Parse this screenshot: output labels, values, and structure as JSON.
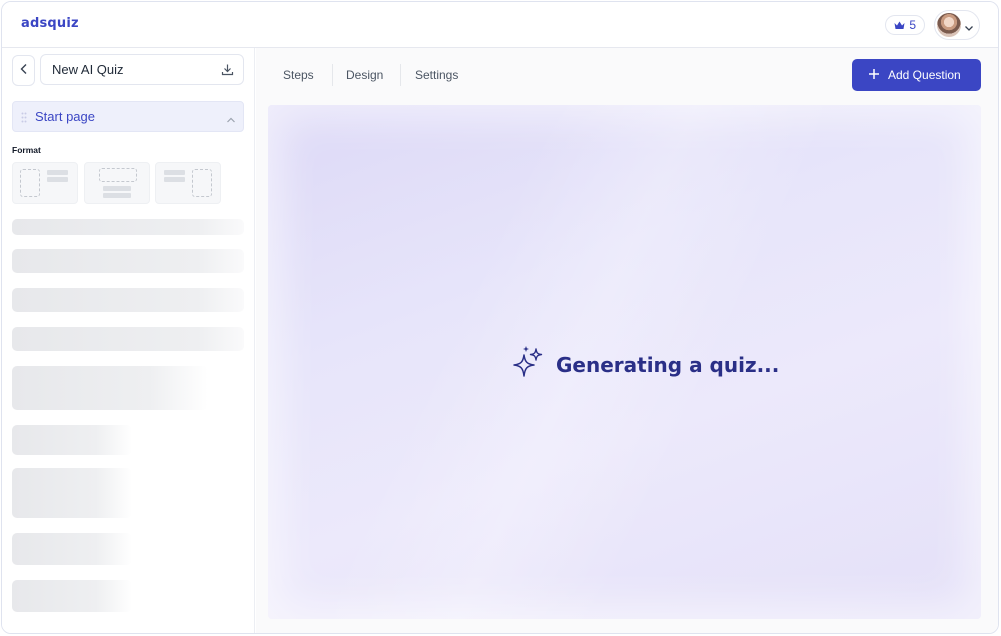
{
  "header": {
    "logo": "adsquiz",
    "credits": "5"
  },
  "sidebar": {
    "quiz_name": "New AI Quiz",
    "section": "Start page",
    "format_label": "Format"
  },
  "tabs": [
    {
      "label": "Steps"
    },
    {
      "label": "Design"
    },
    {
      "label": "Settings"
    }
  ],
  "toolbar": {
    "add_label": "Add Question"
  },
  "canvas": {
    "status": "Generating a quiz..."
  },
  "colors": {
    "accent": "#3b46c4",
    "status_text": "#2a2f87",
    "canvas_bg": "#e7e5fa"
  }
}
